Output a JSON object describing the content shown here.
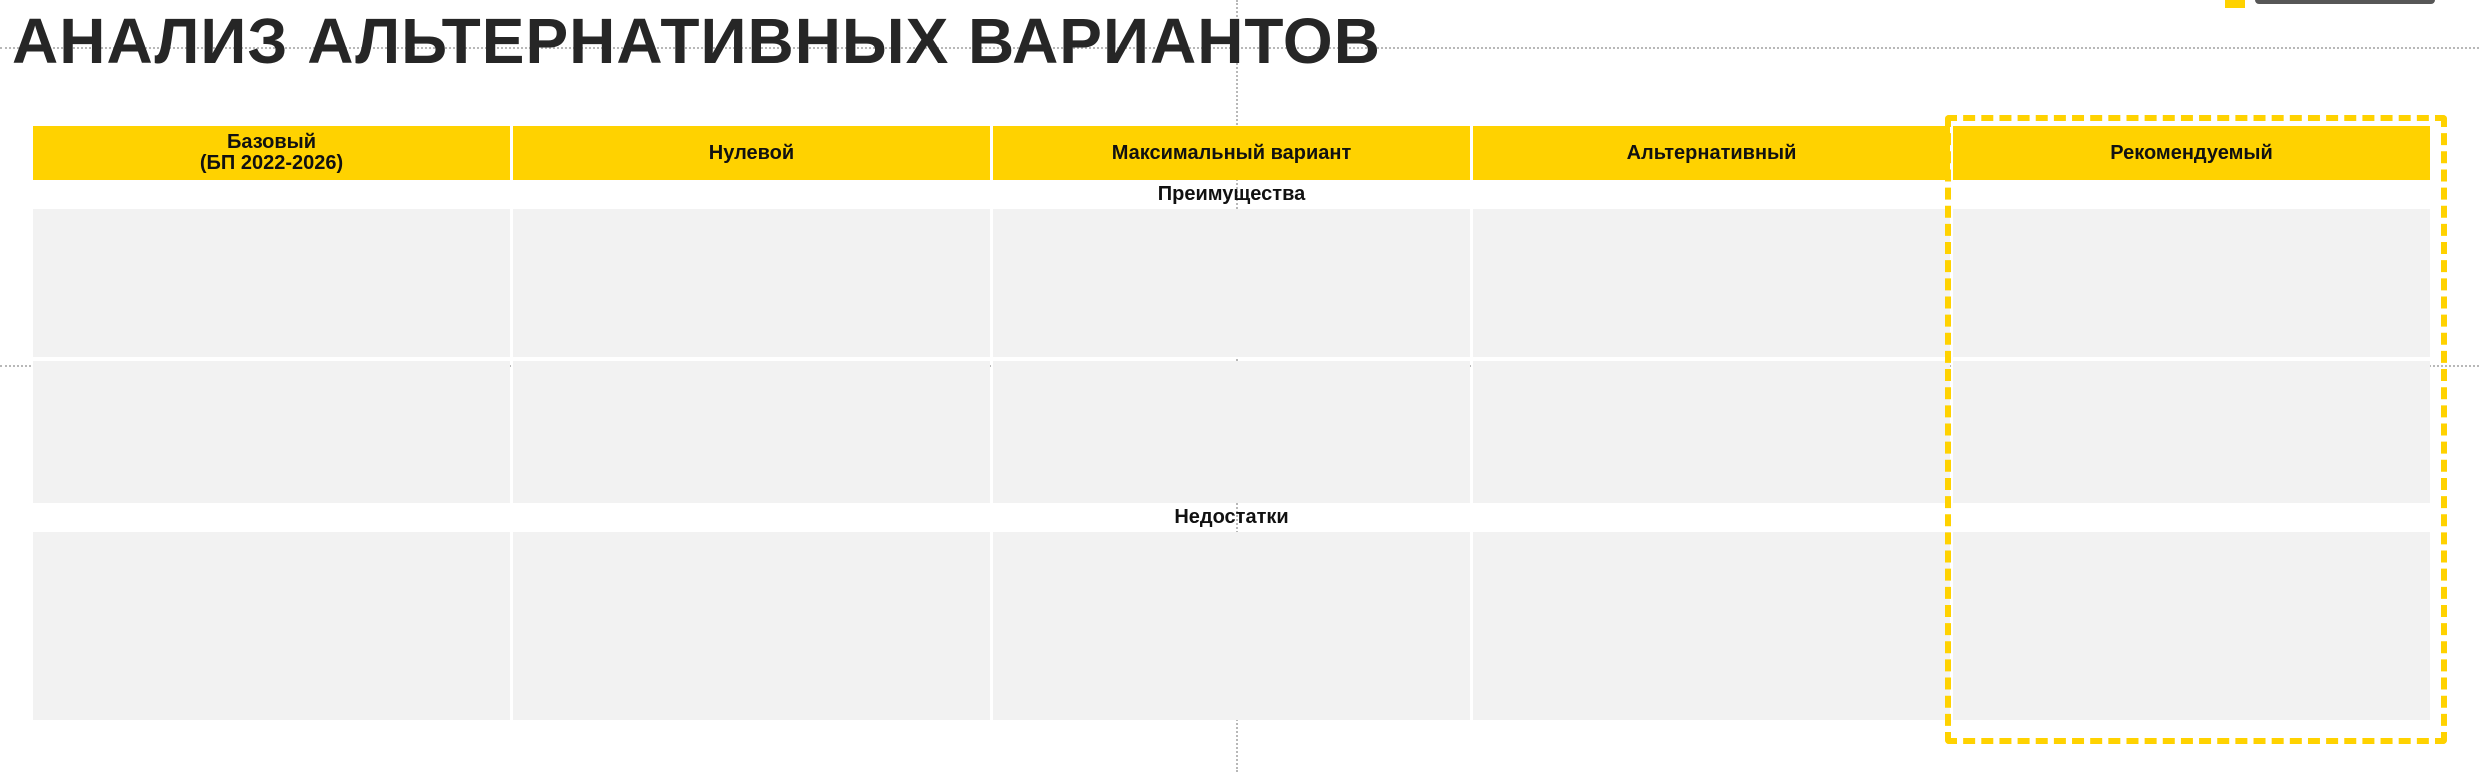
{
  "title": "АНАЛИЗ АЛЬТЕРНАТИВНЫХ ВАРИАНТОВ",
  "table": {
    "columns": [
      {
        "line1": "Базовый",
        "line2": "(БП 2022-2026)"
      },
      {
        "line1": "Нулевой"
      },
      {
        "line1": "Максимальный вариант"
      },
      {
        "line1": "Альтернативный"
      },
      {
        "line1": "Рекомендуемый"
      }
    ],
    "sections": {
      "advantages": "Преимущества",
      "disadvantages": "Недостатки"
    }
  },
  "colors": {
    "accent": "#ffd200",
    "cell": "#f2f2f2"
  }
}
